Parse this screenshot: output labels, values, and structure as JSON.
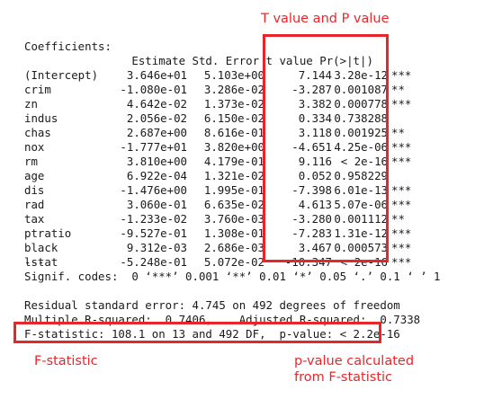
{
  "annotations": {
    "t_and_p_value": "T value and P value",
    "f_statistic": "F-statistic",
    "p_value_from_f": "p-value calculated\nfrom F-statistic"
  },
  "colors": {
    "annotation": "#e8262a",
    "text": "#1a1a1a",
    "background": "#ffffff"
  },
  "output": {
    "coefficients_title": "Coefficients:",
    "header": "                Estimate Std. Error t value Pr(>|t|)",
    "rows": [
      {
        "name": "(Intercept)",
        "estimate": "3.646e+01",
        "std_error": "5.103e+00",
        "t_value": "7.144",
        "p_value": "3.28e-12",
        "signif": "***"
      },
      {
        "name": "crim",
        "estimate": "-1.080e-01",
        "std_error": "3.286e-02",
        "t_value": "-3.287",
        "p_value": "0.001087",
        "signif": "**"
      },
      {
        "name": "zn",
        "estimate": "4.642e-02",
        "std_error": "1.373e-02",
        "t_value": "3.382",
        "p_value": "0.000778",
        "signif": "***"
      },
      {
        "name": "indus",
        "estimate": "2.056e-02",
        "std_error": "6.150e-02",
        "t_value": "0.334",
        "p_value": "0.738288",
        "signif": ""
      },
      {
        "name": "chas",
        "estimate": "2.687e+00",
        "std_error": "8.616e-01",
        "t_value": "3.118",
        "p_value": "0.001925",
        "signif": "**"
      },
      {
        "name": "nox",
        "estimate": "-1.777e+01",
        "std_error": "3.820e+00",
        "t_value": "-4.651",
        "p_value": "4.25e-06",
        "signif": "***"
      },
      {
        "name": "rm",
        "estimate": "3.810e+00",
        "std_error": "4.179e-01",
        "t_value": "9.116",
        "p_value": "< 2e-16",
        "signif": "***"
      },
      {
        "name": "age",
        "estimate": "6.922e-04",
        "std_error": "1.321e-02",
        "t_value": "0.052",
        "p_value": "0.958229",
        "signif": ""
      },
      {
        "name": "dis",
        "estimate": "-1.476e+00",
        "std_error": "1.995e-01",
        "t_value": "-7.398",
        "p_value": "6.01e-13",
        "signif": "***"
      },
      {
        "name": "rad",
        "estimate": "3.060e-01",
        "std_error": "6.635e-02",
        "t_value": "4.613",
        "p_value": "5.07e-06",
        "signif": "***"
      },
      {
        "name": "tax",
        "estimate": "-1.233e-02",
        "std_error": "3.760e-03",
        "t_value": "-3.280",
        "p_value": "0.001112",
        "signif": "**"
      },
      {
        "name": "ptratio",
        "estimate": "-9.527e-01",
        "std_error": "1.308e-01",
        "t_value": "-7.283",
        "p_value": "1.31e-12",
        "signif": "***"
      },
      {
        "name": "black",
        "estimate": "9.312e-03",
        "std_error": "2.686e-03",
        "t_value": "3.467",
        "p_value": "0.000573",
        "signif": "***"
      },
      {
        "name": "lstat",
        "estimate": "-5.248e-01",
        "std_error": "5.072e-02",
        "t_value": "-10.347",
        "p_value": "< 2e-16",
        "signif": "***"
      }
    ],
    "separator": "---",
    "signif_codes": "Signif. codes:  0 ‘***’ 0.001 ‘**’ 0.01 ‘*’ 0.05 ‘.’ 0.1 ‘ ’ 1",
    "residual_se": "Residual standard error: 4.745 on 492 degrees of freedom",
    "r_squared": "Multiple R-squared:  0.7406,    Adjusted R-squared:  0.7338",
    "f_statistic": "F-statistic: 108.1 on 13 and 492 DF,  p-value: < 2.2e-16"
  }
}
